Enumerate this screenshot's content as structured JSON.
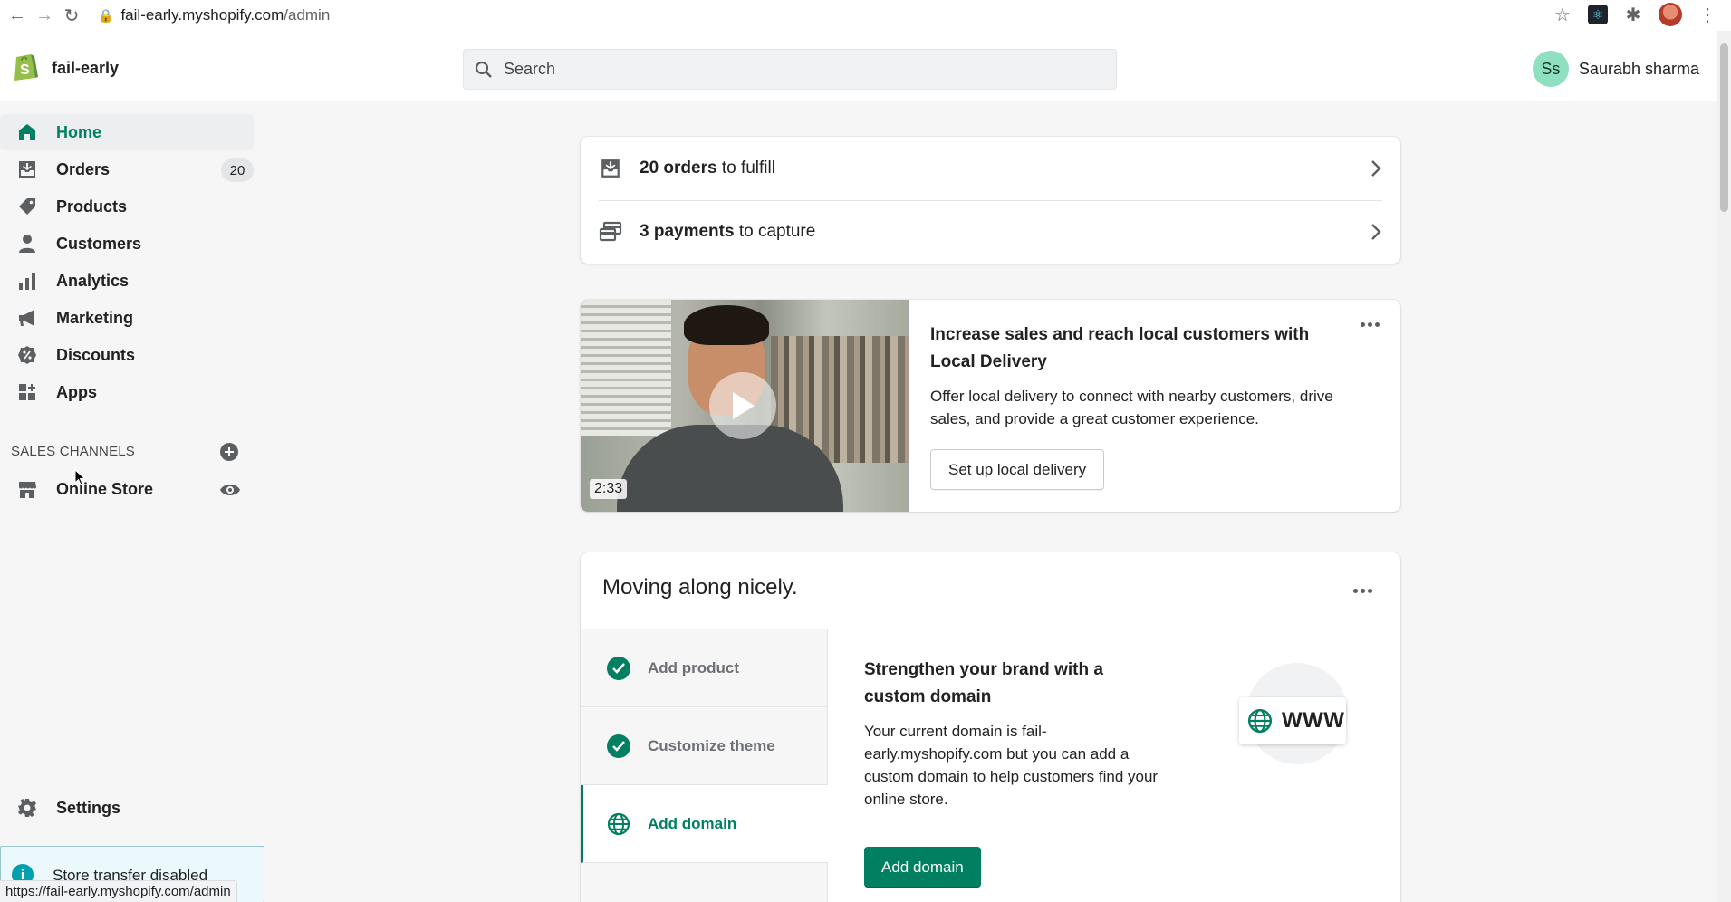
{
  "browser": {
    "url_host": "fail-early.myshopify.com",
    "url_path": "/admin",
    "status_url": "https://fail-early.myshopify.com/admin"
  },
  "topbar": {
    "store_name": "fail-early",
    "search_placeholder": "Search",
    "user_initials": "Ss",
    "user_name": "Saurabh sharma"
  },
  "sidebar": {
    "items": [
      {
        "label": "Home",
        "icon": "home-icon",
        "active": true
      },
      {
        "label": "Orders",
        "icon": "orders-icon",
        "badge": "20"
      },
      {
        "label": "Products",
        "icon": "tag-icon"
      },
      {
        "label": "Customers",
        "icon": "person-icon"
      },
      {
        "label": "Analytics",
        "icon": "bar-chart-icon"
      },
      {
        "label": "Marketing",
        "icon": "megaphone-icon"
      },
      {
        "label": "Discounts",
        "icon": "discount-icon"
      },
      {
        "label": "Apps",
        "icon": "apps-icon"
      }
    ],
    "sales_channels_title": "SALES CHANNELS",
    "online_store": "Online Store",
    "settings": "Settings",
    "transfer_notice": "Store transfer disabled"
  },
  "tasks": {
    "orders_count": "20 orders",
    "orders_rest": " to fulfill",
    "payments_count": "3 payments",
    "payments_rest": " to capture"
  },
  "promo": {
    "duration": "2:33",
    "title": "Increase sales and reach local customers with Local Delivery",
    "text": "Offer local delivery to connect with nearby customers, drive sales, and provide a great customer experience.",
    "button": "Set up local delivery"
  },
  "setup": {
    "title": "Moving along nicely.",
    "steps": [
      {
        "label": "Add product",
        "done": true
      },
      {
        "label": "Customize theme",
        "done": true
      },
      {
        "label": "Add domain",
        "active": true
      }
    ],
    "detail_title": "Strengthen your brand with a custom domain",
    "detail_text": "Your current domain is fail-early.myshopify.com but you can add a custom domain to help customers find your online store.",
    "detail_button": "Add domain",
    "illustration_text": "WWW"
  },
  "colors": {
    "accent": "#008060",
    "info": "#00a0ac"
  }
}
